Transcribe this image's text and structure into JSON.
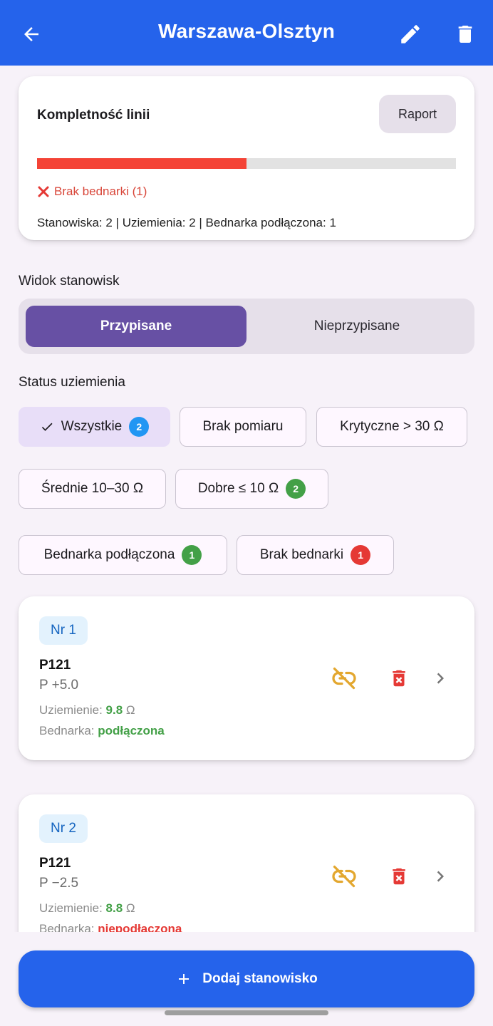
{
  "appbar": {
    "title": "Warszawa-Olsztyn",
    "icons": {
      "back": "arrow-back-icon",
      "edit": "pencil-icon",
      "delete": "trash-icon"
    },
    "color": "#2563eb"
  },
  "summary": {
    "title": "Kompletność linii",
    "report_label": "Raport",
    "progress_fraction": 0.5,
    "progress_color": "#f44336",
    "error_icon": "cross-icon",
    "error_text": "Brak bednarki (1)",
    "stats": "Stanowiska: 2 | Uziemienia: 2 | Bednarka podłączona: 1"
  },
  "view": {
    "label": "Widok stanowisk",
    "segments": [
      {
        "label": "Przypisane",
        "active": true
      },
      {
        "label": "Nieprzypisane",
        "active": false
      }
    ]
  },
  "status": {
    "label": "Status uziemienia",
    "chips": [
      {
        "label": "Wszystkie",
        "selected": true,
        "badge": "2",
        "badge_color": "#2196f3"
      },
      {
        "label": "Brak pomiaru",
        "selected": false
      },
      {
        "label": "Krytyczne > 30 Ω",
        "selected": false
      },
      {
        "label": "Średnie 10–30 Ω",
        "selected": false
      },
      {
        "label": "Dobre ≤ 10 Ω",
        "selected": false,
        "badge": "2",
        "badge_color": "#43a047"
      },
      {
        "label": "Bednarka podłączona",
        "selected": false,
        "badge": "1",
        "badge_color": "#43a047"
      },
      {
        "label": "Brak bednarki",
        "selected": false,
        "badge": "1",
        "badge_color": "#e53935"
      }
    ]
  },
  "stations": [
    {
      "nr": "Nr 1",
      "name": "P121",
      "position": "P +5.0",
      "grounding_label": "Uziemienie: ",
      "grounding_value": "9.8",
      "grounding_unit": " Ω",
      "flat_label": "Bednarka: ",
      "flat_value": "podłączona",
      "flat_ok": true
    },
    {
      "nr": "Nr 2",
      "name": "P121",
      "position": "P −2.5",
      "grounding_label": "Uziemienie: ",
      "grounding_value": "8.8",
      "grounding_unit": " Ω",
      "flat_label": "Bednarka: ",
      "flat_value": "niepodłączona",
      "flat_ok": false
    }
  ],
  "fab": {
    "label": "Dodaj stanowisko",
    "icon": "plus-icon"
  },
  "colors": {
    "unlink": "#e3a72f",
    "delete": "#e53935",
    "chevron": "#757575"
  }
}
